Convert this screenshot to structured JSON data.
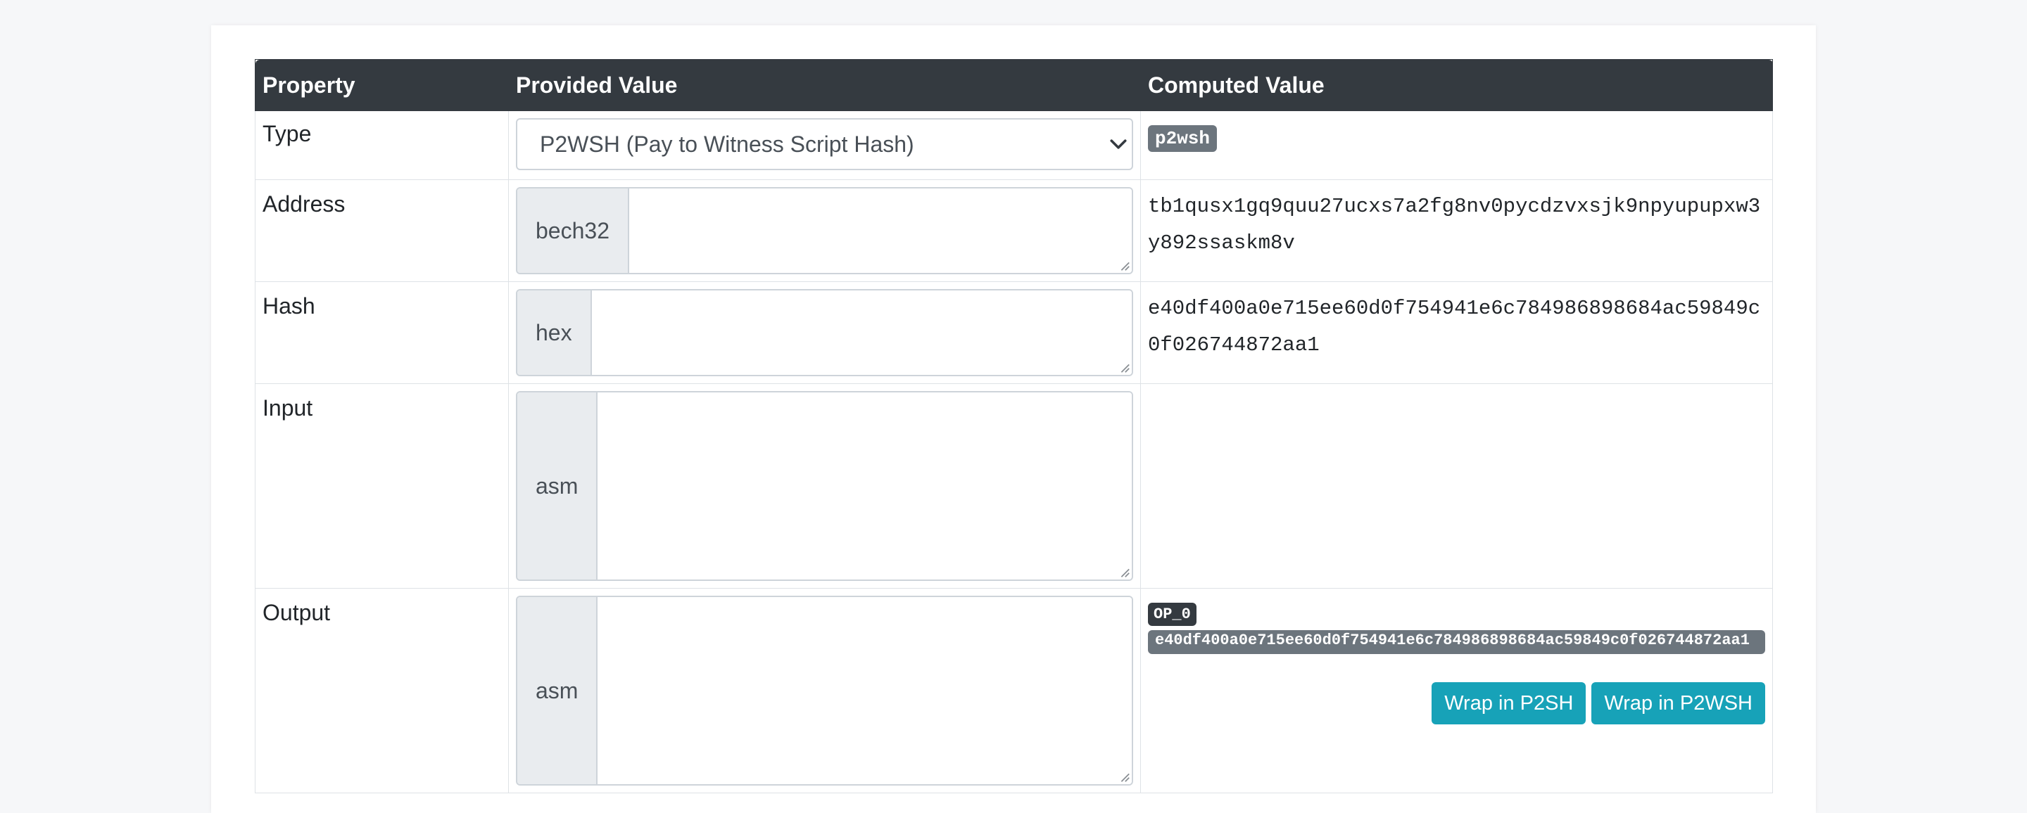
{
  "table": {
    "headers": {
      "property": "Property",
      "provided": "Provided Value",
      "computed": "Computed Value"
    }
  },
  "rows": {
    "type": {
      "label": "Type",
      "select_value": "P2WSH (Pay to Witness Script Hash)",
      "computed_badge": "p2wsh"
    },
    "address": {
      "label": "Address",
      "addon": "bech32",
      "value": "",
      "computed": "tb1qusx1gq9quu27ucxs7a2fg8nv0pycdzvxsjk9npyupupxw3y892ssaskm8v"
    },
    "hash": {
      "label": "Hash",
      "addon": "hex",
      "value": "",
      "computed": "e40df400a0e715ee60d0f754941e6c784986898684ac59849c0f026744872aa1"
    },
    "input": {
      "label": "Input",
      "addon": "asm",
      "value": ""
    },
    "output": {
      "label": "Output",
      "addon": "asm",
      "value": "",
      "op_badge": "OP_0",
      "hash_badge": "e40df400a0e715ee60d0f754941e6c784986898684ac59849c0f026744872aa1",
      "wrap_p2sh": "Wrap in P2SH",
      "wrap_p2wsh": "Wrap in P2WSH"
    }
  },
  "colors": {
    "header_bg": "#343a40",
    "badge_gray": "#6c757d",
    "badge_dark": "#343a40",
    "button_info": "#17a2b8",
    "addon_bg": "#e9ecef"
  },
  "icons": {
    "select_arrow": "chevron-down-icon",
    "resize": "resize-grip-icon"
  }
}
